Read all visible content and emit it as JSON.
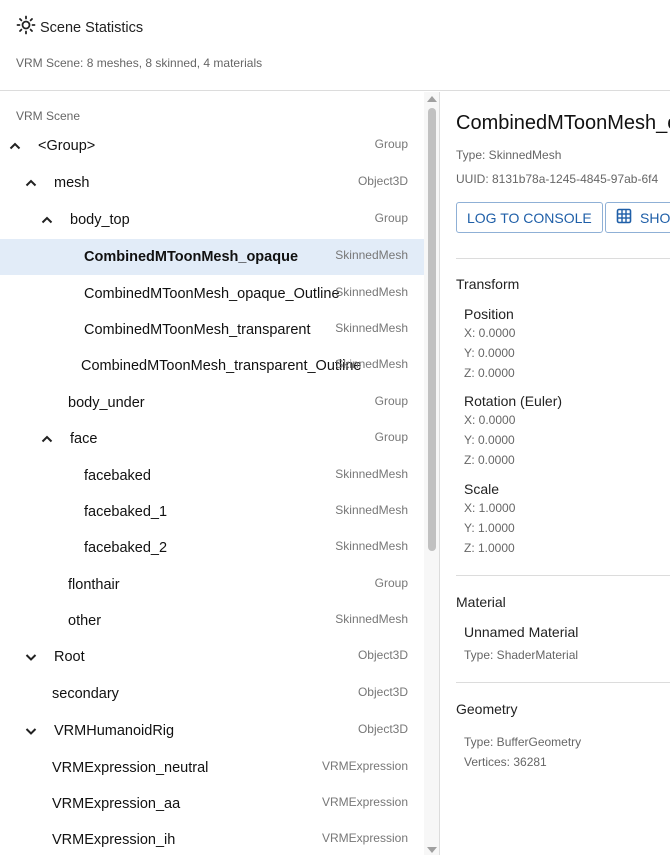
{
  "header": {
    "title": "Scene Statistics",
    "subtitle": "VRM Scene: 8 meshes, 8 skinned, 4 materials"
  },
  "tree": {
    "root_label": "VRM Scene",
    "rows": [
      {
        "name": "<Group>",
        "type": "Group",
        "chevron": "up"
      },
      {
        "name": "mesh",
        "type": "Object3D",
        "chevron": "up"
      },
      {
        "name": "body_top",
        "type": "Group",
        "chevron": "up"
      },
      {
        "name": "CombinedMToonMesh_opaque",
        "type": "SkinnedMesh",
        "selected": true
      },
      {
        "name": "CombinedMToonMesh_opaque_Outline",
        "type": "SkinnedMesh"
      },
      {
        "name": "CombinedMToonMesh_transparent",
        "type": "SkinnedMesh"
      },
      {
        "name": "CombinedMToonMesh_transparent_Outline",
        "type": "SkinnedMesh"
      },
      {
        "name": "body_under",
        "type": "Group"
      },
      {
        "name": "face",
        "type": "Group",
        "chevron": "up"
      },
      {
        "name": "facebaked",
        "type": "SkinnedMesh"
      },
      {
        "name": "facebaked_1",
        "type": "SkinnedMesh"
      },
      {
        "name": "facebaked_2",
        "type": "SkinnedMesh"
      },
      {
        "name": "flonthair",
        "type": "Group"
      },
      {
        "name": "other",
        "type": "SkinnedMesh"
      },
      {
        "name": "Root",
        "type": "Object3D",
        "chevron": "down"
      },
      {
        "name": "secondary",
        "type": "Object3D"
      },
      {
        "name": "VRMHumanoidRig",
        "type": "Object3D",
        "chevron": "down"
      },
      {
        "name": "VRMExpression_neutral",
        "type": "VRMExpression"
      },
      {
        "name": "VRMExpression_aa",
        "type": "VRMExpression"
      },
      {
        "name": "VRMExpression_ih",
        "type": "VRMExpression"
      }
    ]
  },
  "detail": {
    "title": "CombinedMToonMesh_opaque",
    "type_line": "Type: SkinnedMesh",
    "uuid_line": "UUID: 8131b78a-1245-4845-97ab-6f4",
    "log_button": "LOG TO CONSOLE",
    "show_button": "SHOW",
    "transform": {
      "title": "Transform",
      "position": {
        "label": "Position",
        "x": "X: 0.0000",
        "y": "Y: 0.0000",
        "z": "Z: 0.0000"
      },
      "rotation": {
        "label": "Rotation (Euler)",
        "x": "X: 0.0000",
        "y": "Y: 0.0000",
        "z": "Z: 0.0000"
      },
      "scale": {
        "label": "Scale",
        "x": "X: 1.0000",
        "y": "Y: 1.0000",
        "z": "Z: 1.0000"
      }
    },
    "material": {
      "title": "Material",
      "name": "Unnamed Material",
      "type_line": "Type: ShaderMaterial"
    },
    "geometry": {
      "title": "Geometry",
      "type_line": "Type: BufferGeometry",
      "vertices_line": "Vertices: 36281"
    }
  },
  "icons": {
    "header": "sun-icon",
    "chevron_up": "chevron-up-icon",
    "chevron_down": "chevron-down-icon",
    "show": "grid-icon"
  },
  "colors": {
    "selected_row": "#e2ecf8",
    "accent": "#1f5fa8"
  }
}
